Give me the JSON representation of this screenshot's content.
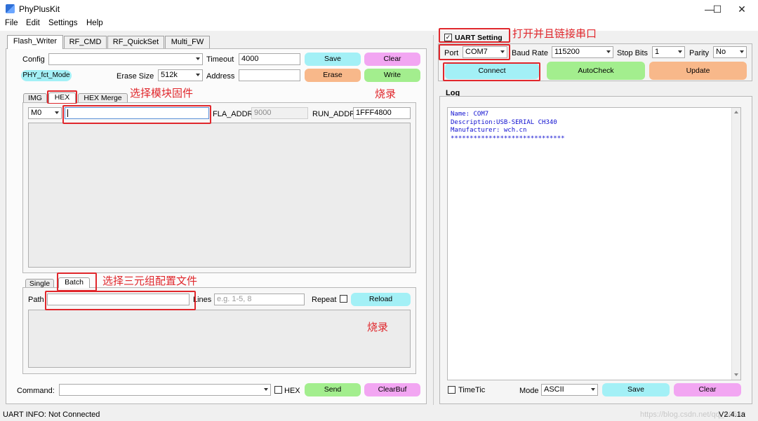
{
  "window": {
    "title": "PhyPlusKit",
    "min_glyph": "—",
    "max_glyph": "☐",
    "close_glyph": "✕"
  },
  "menu": [
    "File",
    "Edit",
    "Settings",
    "Help"
  ],
  "left_tabs": [
    "Flash_Writer",
    "RF_CMD",
    "RF_QuickSet",
    "Multi_FW"
  ],
  "flash": {
    "config_label": "Config",
    "config_value": "",
    "timeout_label": "Timeout",
    "timeout_value": "4000",
    "save_label": "Save",
    "clear_label": "Clear",
    "mode_chip": "PHY_fct_Mode",
    "erase_size_label": "Erase Size",
    "erase_size_value": "512k",
    "address_label": "Address",
    "address_value": "",
    "erase_label": "Erase",
    "write_label": "Write",
    "file_tabs": [
      "IMG",
      "HEX",
      "HEX Merge"
    ],
    "mode_value": "M0",
    "hex_path": "",
    "fla_addr_label": "FLA_ADDR",
    "fla_addr_value": "9000",
    "run_addr_label": "RUN_ADDR",
    "run_addr_value": "1FFF4800",
    "batch_tabs": [
      "Single",
      "Batch"
    ],
    "path_label": "Path",
    "path_value": "",
    "lines_label": "Lines",
    "lines_placeholder": "e.g. 1-5, 8",
    "repeat_label": "Repeat",
    "reload_label": "Reload",
    "command_label": "Command:",
    "command_value": "",
    "hex_check_label": "HEX",
    "send_label": "Send",
    "clearbuf_label": "ClearBuf"
  },
  "uart": {
    "setting_label": "UART Setting",
    "setting_checked": true,
    "port_label": "Port",
    "port_value": "COM7",
    "baud_label": "Baud Rate",
    "baud_value": "115200",
    "stop_label": "Stop Bits",
    "stop_value": "1",
    "parity_label": "Parity",
    "parity_value": "No",
    "connect_label": "Connect",
    "autocheck_label": "AutoCheck",
    "update_label": "Update",
    "log_label": "Log",
    "log_lines": [
      "Name: COM7",
      "Description:USB-SERIAL CH340",
      "Manufacturer: wch.cn",
      "******************************"
    ],
    "timetic_label": "TimeTic",
    "mode_label": "Mode",
    "mode_value": "ASCII",
    "save_label": "Save",
    "clear_label": "Clear"
  },
  "annotations": {
    "select_firmware": "选择模块固件",
    "burn_top": "烧录",
    "select_triple": "选择三元组配置文件",
    "burn_bottom": "烧录",
    "open_uart": "打开并且链接串口"
  },
  "status": {
    "info": "UART INFO:  Not Connected",
    "version": "V2.4.1a",
    "watermark": "https://blog.csdn.net/qq_40549"
  },
  "colors": {
    "annotation_red": "#e0272c",
    "button_cyan": "#a3f0f6",
    "button_pink": "#f2a6f2",
    "button_orange": "#f8b88a",
    "button_green": "#a3ee8e",
    "log_text_blue": "#1010d0"
  }
}
